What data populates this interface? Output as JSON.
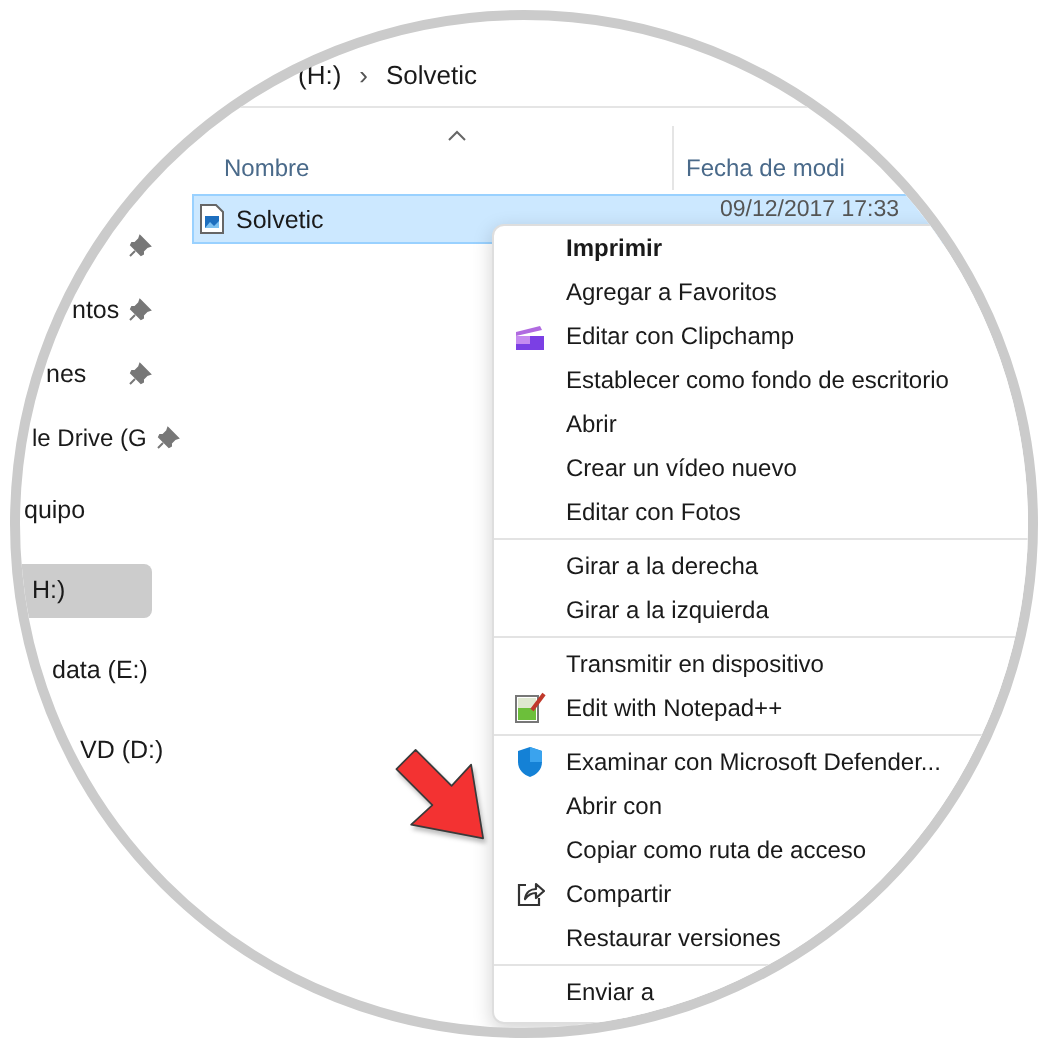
{
  "address_bar": {
    "breadcrumbs": [
      "(H:)",
      "Solvetic"
    ],
    "separator": "›"
  },
  "sidebar": {
    "items": [
      {
        "pinned": true,
        "selected": false
      },
      {
        "label": "ntos",
        "pinned": true,
        "selected": false
      },
      {
        "label": "nes",
        "pinned": true,
        "selected": false
      },
      {
        "label": "le Drive (G",
        "pinned": true,
        "selected": false
      },
      {
        "label": "quipo",
        "pinned": false,
        "selected": false
      },
      {
        "label": "H:)",
        "pinned": false,
        "selected": true
      },
      {
        "label": "data (E:)",
        "pinned": false,
        "selected": false
      },
      {
        "label": "VD (D:)",
        "pinned": false,
        "selected": false
      }
    ]
  },
  "file_list": {
    "columns": [
      {
        "label": "Nombre",
        "sorted": true
      },
      {
        "label": "Fecha de modi",
        "sorted": false
      }
    ],
    "rows": [
      {
        "name": "Solvetic",
        "date": "09/12/2017 17:33",
        "selected": true
      }
    ]
  },
  "context_menu": {
    "groups": [
      [
        {
          "label": "Imprimir",
          "bold": true,
          "kind": "plain"
        },
        {
          "label": "Agregar a Favoritos",
          "bold": false,
          "kind": "plain"
        },
        {
          "label": "Editar con Clipchamp",
          "bold": false,
          "kind": "clapperboard"
        },
        {
          "label": "Establecer como fondo de escritorio",
          "bold": false,
          "kind": "plain"
        },
        {
          "label": "Abrir",
          "bold": false,
          "kind": "plain"
        },
        {
          "label": "Crear un vídeo nuevo",
          "bold": false,
          "kind": "plain"
        },
        {
          "label": "Editar con Fotos",
          "bold": false,
          "kind": "plain"
        }
      ],
      [
        {
          "label": "Girar a la derecha",
          "bold": false,
          "kind": "plain"
        },
        {
          "label": "Girar a la izquierda",
          "bold": false,
          "kind": "plain"
        }
      ],
      [
        {
          "label": "Transmitir en dispositivo",
          "bold": false,
          "kind": "plain"
        },
        {
          "label": "Edit with Notepad++",
          "bold": false,
          "kind": "notepad"
        }
      ],
      [
        {
          "label": "Examinar con Microsoft Defender...",
          "bold": false,
          "kind": "shield"
        },
        {
          "label": "Abrir con",
          "bold": false,
          "kind": "plain"
        },
        {
          "label": "Copiar como ruta de acceso",
          "bold": false,
          "kind": "plain"
        },
        {
          "label": "Compartir",
          "bold": false,
          "kind": "share"
        },
        {
          "label": "Restaurar versiones",
          "bold": false,
          "kind": "plain"
        }
      ],
      [
        {
          "label": "Enviar a",
          "bold": false,
          "kind": "plain"
        }
      ]
    ]
  }
}
